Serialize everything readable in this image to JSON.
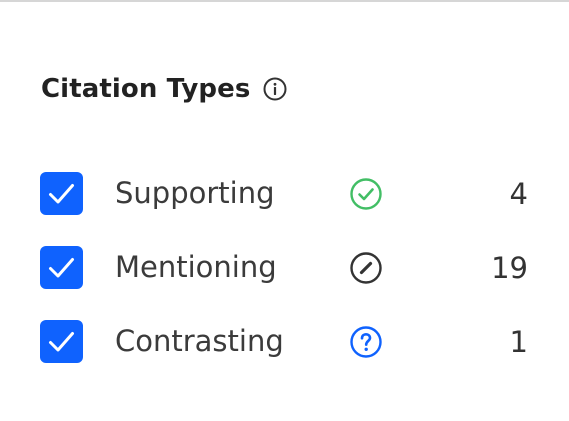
{
  "panel": {
    "title": "Citation Types",
    "info_icon": "info-icon",
    "checkbox_color": "#0f62fe",
    "items": [
      {
        "label": "Supporting",
        "count": "4",
        "checked": true,
        "icon": "check-circle-icon",
        "icon_color": "#42be65"
      },
      {
        "label": "Mentioning",
        "count": "19",
        "checked": true,
        "icon": "slash-circle-icon",
        "icon_color": "#333333"
      },
      {
        "label": "Contrasting",
        "count": "1",
        "checked": true,
        "icon": "question-circle-icon",
        "icon_color": "#0f62fe"
      }
    ]
  }
}
